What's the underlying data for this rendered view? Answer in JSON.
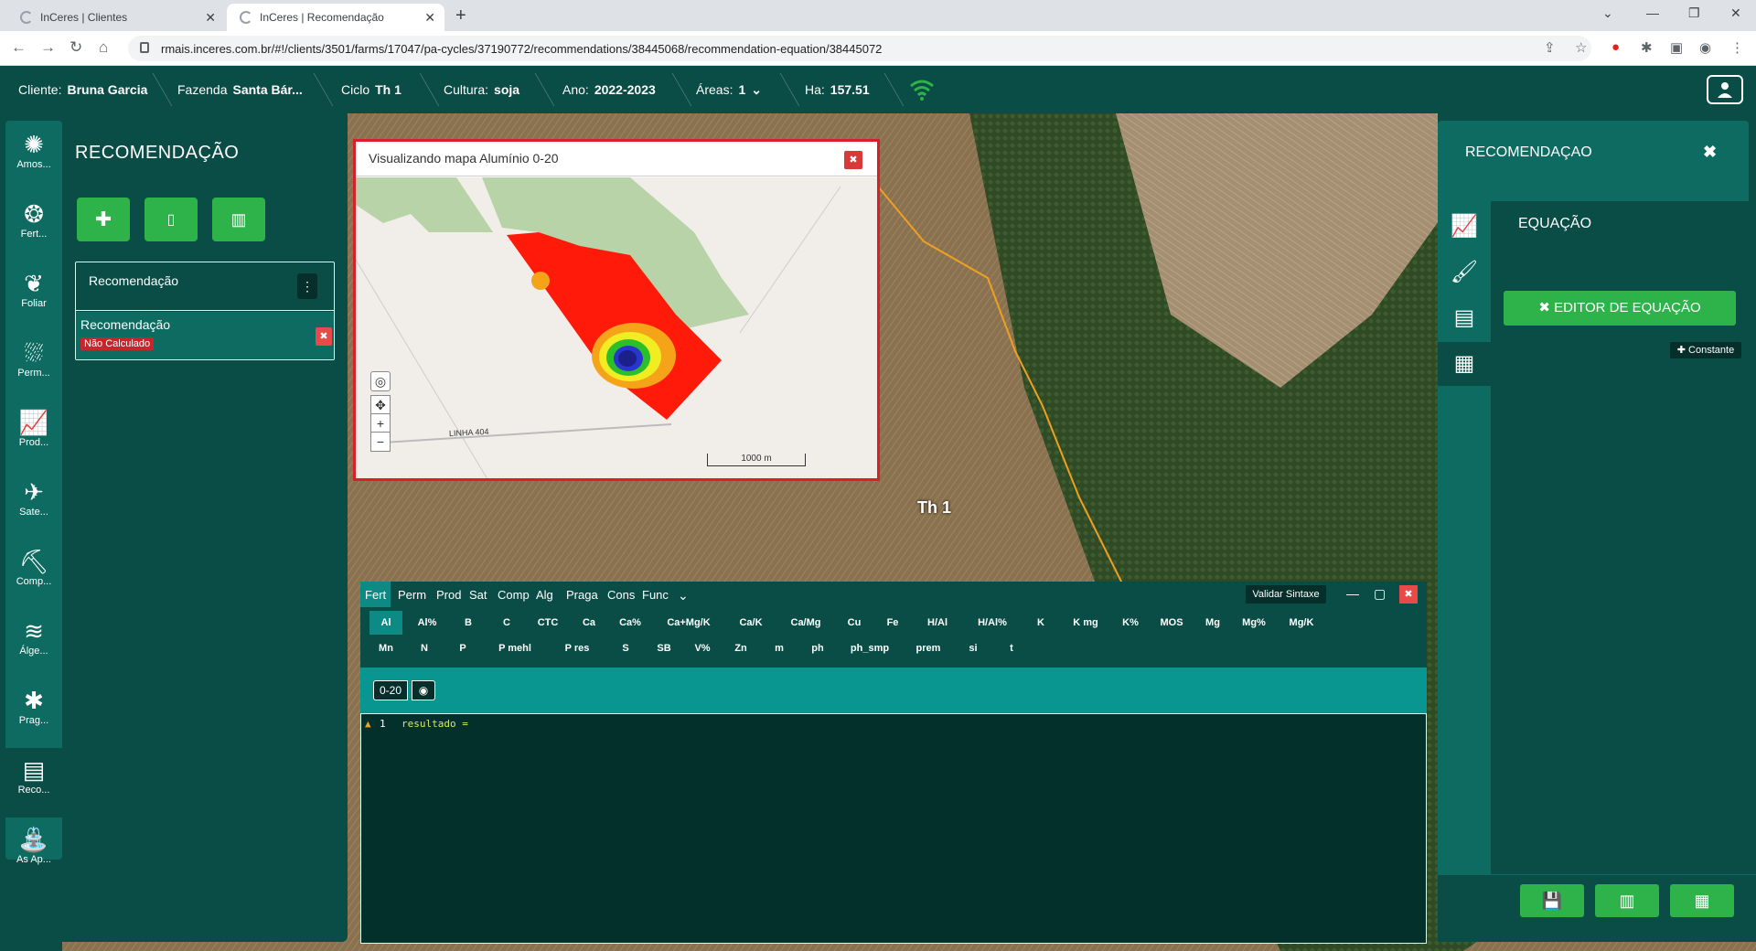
{
  "browser": {
    "tabs": [
      {
        "title": "InCeres | Clientes",
        "active": false
      },
      {
        "title": "InCeres | Recomendação",
        "active": true
      }
    ],
    "url": "rmais.inceres.com.br/#!/clients/3501/farms/17047/pa-cycles/37190772/recommendations/38445068/recommendation-equation/38445072"
  },
  "header": {
    "cliente_label": "Cliente:",
    "cliente_value": "Bruna Garcia",
    "fazenda_label": "Fazenda",
    "fazenda_value": "Santa Bár...",
    "ciclo_label": "Ciclo",
    "ciclo_value": "Th 1",
    "cultura_label": "Cultura:",
    "cultura_value": "soja",
    "ano_label": "Ano:",
    "ano_value": "2022-2023",
    "areas_label": "Áreas:",
    "areas_value": "1",
    "ha_label": "Ha:",
    "ha_value": "157.51"
  },
  "sidebar": {
    "items": [
      {
        "label": "Amos...",
        "icon": "samples-icon"
      },
      {
        "label": "Fert...",
        "icon": "fertility-icon"
      },
      {
        "label": "Foliar",
        "icon": "leaf-icon"
      },
      {
        "label": "Perm...",
        "icon": "permeability-icon"
      },
      {
        "label": "Prod...",
        "icon": "productivity-icon"
      },
      {
        "label": "Sate...",
        "icon": "satellite-icon"
      },
      {
        "label": "Comp...",
        "icon": "compaction-icon"
      },
      {
        "label": "Álge...",
        "icon": "layers-icon"
      },
      {
        "label": "Prag...",
        "icon": "bug-icon"
      },
      {
        "label": "Reco...",
        "icon": "recommendation-icon"
      },
      {
        "label": "As Ap...",
        "icon": "sprayer-icon"
      }
    ]
  },
  "left_panel": {
    "title": "RECOMENDAÇÃO",
    "list_header": "Recomendação",
    "item_name": "Recomendação",
    "item_status": "Não Calculado"
  },
  "map_popup": {
    "title": "Visualizando mapa Alumínio 0-20",
    "road_label": "LINHA 404",
    "scale_label": "1000 m"
  },
  "map": {
    "field_label": "Th 1"
  },
  "editor": {
    "tabs": [
      "Fert",
      "Perm",
      "Prod",
      "Sat",
      "Comp",
      "Alg",
      "Praga",
      "Cons",
      "Func"
    ],
    "active_tab": "Fert",
    "validar_label": "Validar Sintaxe",
    "variables_row1": [
      "Al",
      "Al%",
      "B",
      "C",
      "CTC",
      "Ca",
      "Ca%",
      "Ca+Mg/K",
      "Ca/K",
      "Ca/Mg",
      "Cu",
      "Fe",
      "H/Al",
      "H/Al%",
      "K",
      "K mg",
      "K%",
      "MOS",
      "Mg",
      "Mg%",
      "Mg/K"
    ],
    "variables_row2": [
      "Mn",
      "N",
      "P",
      "P mehl",
      "P res",
      "S",
      "SB",
      "V%",
      "Zn",
      "m",
      "ph",
      "ph_smp",
      "prem",
      "si",
      "t"
    ],
    "depth_label": "0-20",
    "line_number": "1",
    "code": "resultado ="
  },
  "right_panel": {
    "title": "RECOMENDAÇAO",
    "section": "EQUAÇÃO",
    "editor_button": "✖ EDITOR DE EQUAÇÃO",
    "constant_button": "✚ Constante"
  }
}
